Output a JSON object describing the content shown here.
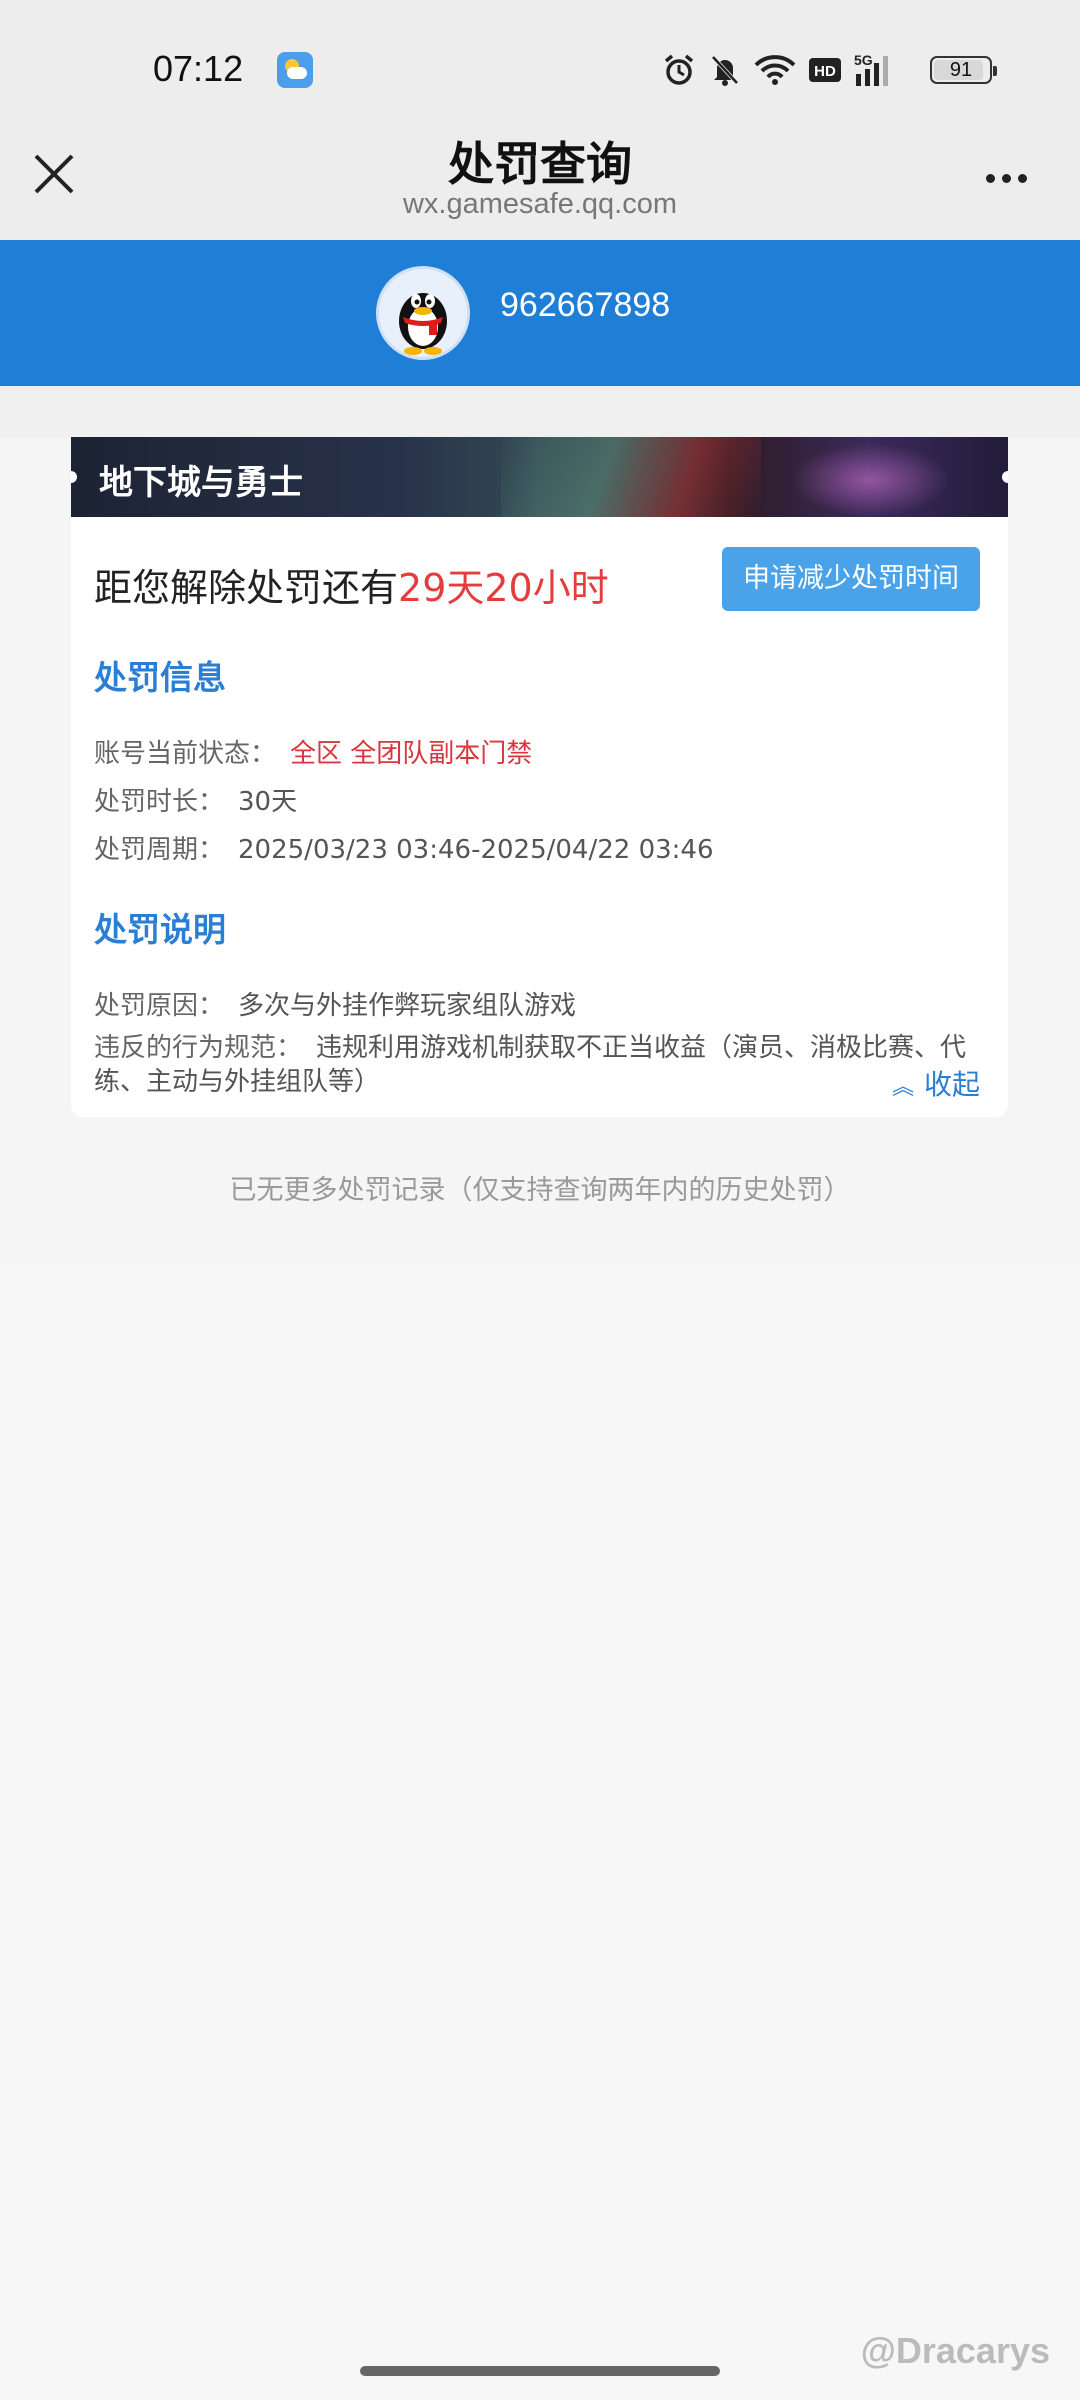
{
  "status_bar": {
    "time": "07:12",
    "battery": "91",
    "icons": [
      "weather-icon",
      "alarm-icon",
      "mute-icon",
      "wifi-icon",
      "hd-icon",
      "signal-5g-icon",
      "battery-icon"
    ]
  },
  "titlebar": {
    "title": "处罚查询",
    "url": "wx.gamesafe.qq.com"
  },
  "user": {
    "qq_number": "962667898"
  },
  "card": {
    "game_name": "地下城与勇士",
    "countdown_prefix": "距您解除处罚还有",
    "countdown_value": "29天20小时",
    "apply_button": "申请减少处罚时间",
    "info_title": "处罚信息",
    "info_rows": [
      {
        "label": "账号当前状态：",
        "value": "全区 全团队副本门禁"
      },
      {
        "label": "处罚时长：",
        "value": "30天"
      },
      {
        "label": "处罚周期：",
        "value": "2025/03/23 03:46-2025/04/22 03:46"
      }
    ],
    "desc_title": "处罚说明",
    "desc_rows": [
      {
        "label": "处罚原因：",
        "value": "多次与外挂作弊玩家组队游戏"
      },
      {
        "label": "违反的行为规范：",
        "value": "违规利用游戏机制获取不正当收益（演员、消极比赛、代练、主动与外挂组队等）"
      }
    ],
    "collapse_label": "收起"
  },
  "footnote": "已无更多处罚记录（仅支持查询两年内的历史处罚）",
  "watermark": "@Dracarys",
  "colors": {
    "brand_blue": "#1f7ed6",
    "accent_red": "#e53d3d",
    "link_blue": "#2a7fd4",
    "button_blue": "#4aa3e8"
  }
}
